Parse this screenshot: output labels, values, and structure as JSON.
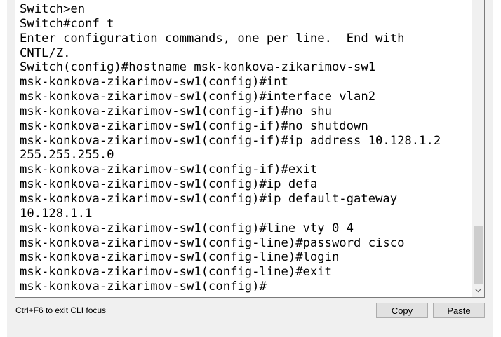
{
  "terminal": {
    "lines": [
      "Switch>en",
      "Switch#conf t",
      "Enter configuration commands, one per line.  End with",
      "CNTL/Z.",
      "Switch(config)#hostname msk-konkova-zikarimov-sw1",
      "msk-konkova-zikarimov-sw1(config)#int",
      "msk-konkova-zikarimov-sw1(config)#interface vlan2",
      "msk-konkova-zikarimov-sw1(config-if)#no shu",
      "msk-konkova-zikarimov-sw1(config-if)#no shutdown",
      "msk-konkova-zikarimov-sw1(config-if)#ip address 10.128.1.2",
      "255.255.255.0",
      "msk-konkova-zikarimov-sw1(config-if)#exit",
      "msk-konkova-zikarimov-sw1(config)#ip defa",
      "msk-konkova-zikarimov-sw1(config)#ip default-gateway",
      "10.128.1.1",
      "msk-konkova-zikarimov-sw1(config)#line vty 0 4",
      "msk-konkova-zikarimov-sw1(config-line)#password cisco",
      "msk-konkova-zikarimov-sw1(config-line)#login",
      "msk-konkova-zikarimov-sw1(config-line)#exit"
    ],
    "prompt": "msk-konkova-zikarimov-sw1(config)#"
  },
  "footer": {
    "hint": "Ctrl+F6 to exit CLI focus",
    "copy_label": "Copy",
    "paste_label": "Paste"
  },
  "icons": {
    "scroll_down": "chevron-down-icon"
  }
}
